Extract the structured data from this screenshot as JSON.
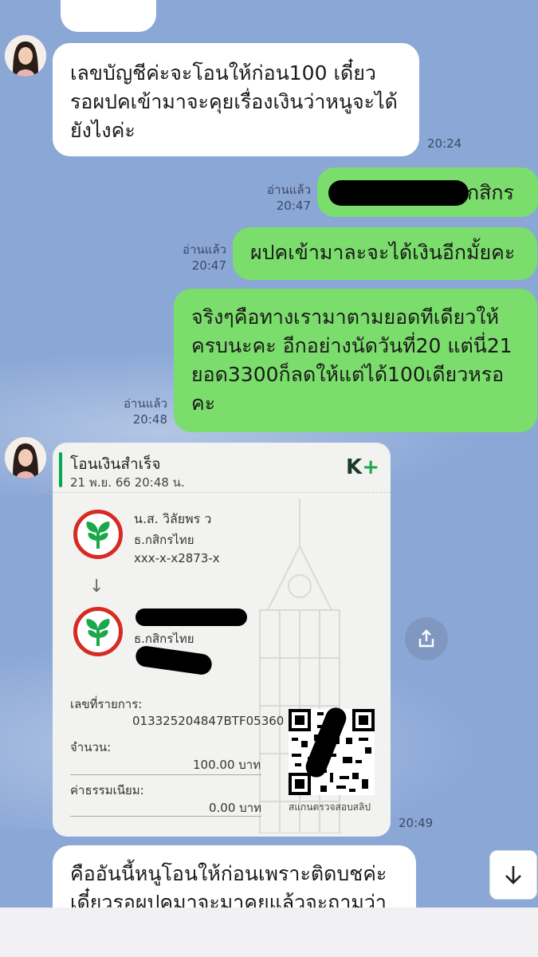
{
  "messages": [
    {
      "id": "m1",
      "side": "in",
      "text_lines": [
        "เลขบัญชีค่ะจะโอนให้ก่อน100 เดี๋ยว",
        "รอผปคเข้ามาจะคุยเรื่องเงินว่าหนูจะได้",
        "ยังไงค่ะ"
      ],
      "time": "20:24"
    },
    {
      "id": "m2",
      "side": "out",
      "text": "กสิกร",
      "read": "อ่านแล้ว",
      "time": "20:47"
    },
    {
      "id": "m3",
      "side": "out",
      "text": "ผปคเข้ามาละจะได้เงินอีกมั้ยคะ",
      "read": "อ่านแล้ว",
      "time": "20:47"
    },
    {
      "id": "m4",
      "side": "out",
      "text_lines": [
        "จริงๆคือทางเรามาตามยอดทีเดียวให้",
        "ครบนะคะ อีกอย่างนัดวันที่20 แต่นี่21",
        "ยอด3300ก็ลดให้แต่ได้100เดียวหรอ",
        "คะ"
      ],
      "read": "อ่านแล้ว",
      "time": "20:48"
    },
    {
      "id": "m6",
      "side": "in",
      "text_lines": [
        "คืออันนี้หนูโอนให้ก่อนเพราะติดบชค่ะ",
        "เดี๋ยวรอผปคมาจะมาคุยแล้วจะถามว่า"
      ]
    }
  ],
  "slip": {
    "title": "โอนเงินสำเร็จ",
    "datetime": "21 พ.ย. 66  20:48 น.",
    "brand_k": "K",
    "brand_plus": "+",
    "sender_name": "น.ส. วิลัยพร ว",
    "sender_bank": "ธ.กสิกรไทย",
    "sender_account": "xxx-x-x2873-x",
    "receiver_bank": "ธ.กสิกรไทย",
    "ref_label": "เลขที่รายการ:",
    "ref_value": "013325204847BTF05360",
    "amount_label": "จำนวน:",
    "amount_value": "100.00 บาท",
    "fee_label": "ค่าธรรมเนียม:",
    "fee_value": "0.00 บาท",
    "qr_caption": "สแกนตรวจสอบสลิป",
    "time": "20:49"
  },
  "icons": {
    "share": "share-icon",
    "scroll_down": "arrow-down-icon"
  },
  "colors": {
    "background": "#8aa7d6",
    "outgoing_bubble": "#7bdd6b",
    "incoming_bubble": "#ffffff",
    "kbank_red": "#d62b22",
    "kbank_green": "#1aa84a"
  }
}
